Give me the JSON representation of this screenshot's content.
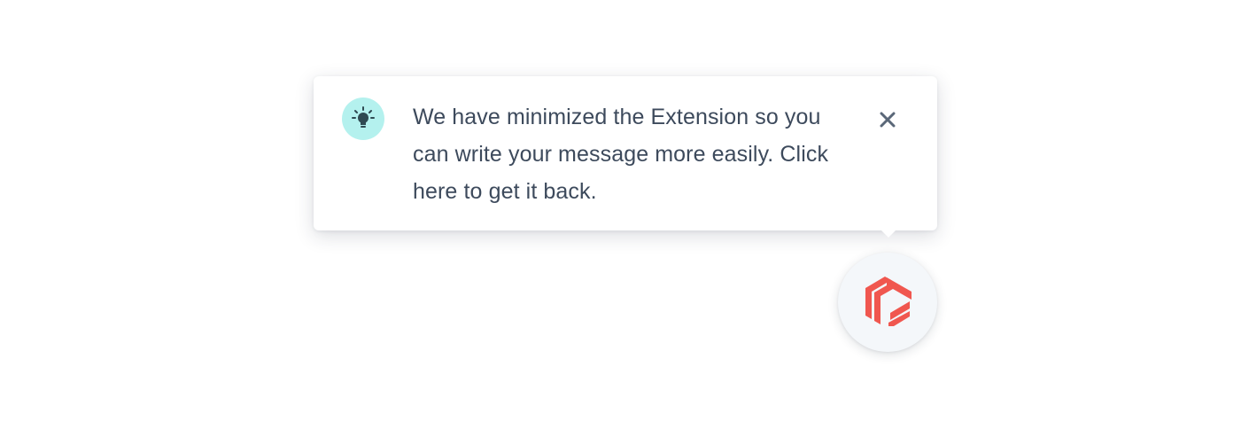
{
  "tooltip": {
    "message": "We have minimized the Extension so you can write your message more easily. Click here to get it back.",
    "icon": "lightbulb-icon",
    "close_icon": "close-icon"
  },
  "launcher": {
    "icon": "extension-logo-icon"
  },
  "colors": {
    "bulb_badge_bg": "#b4f1ee",
    "bulb_icon": "#2f4a52",
    "text": "#3d4a5c",
    "close_icon": "#5a6778",
    "logo": "#f0574f",
    "launcher_bg": "#f4f7fa"
  }
}
